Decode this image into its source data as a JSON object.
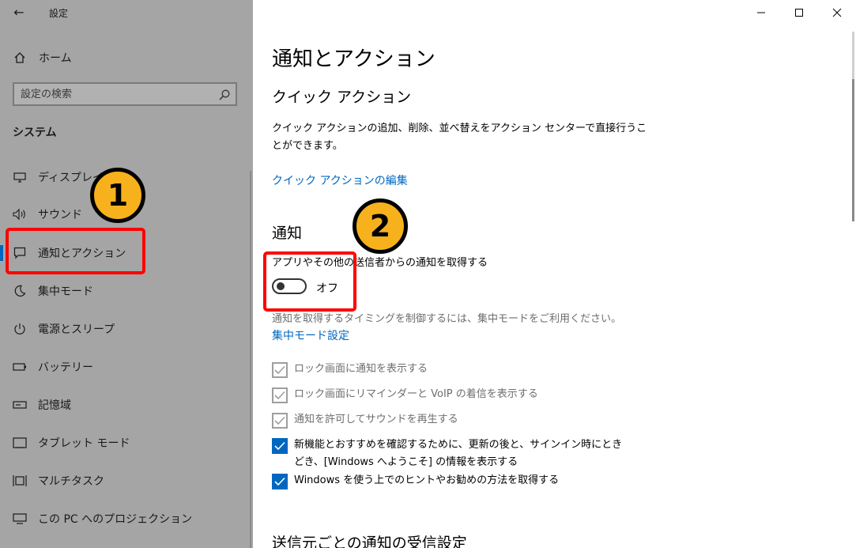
{
  "window": {
    "title": "設定",
    "back_glyph": "←",
    "caption": {
      "minimize": "—",
      "maximize": "☐",
      "close": "✕"
    }
  },
  "sidebar": {
    "home_label": "ホーム",
    "search_placeholder": "設定の検索",
    "section_title": "システム",
    "items": [
      {
        "label": "ディスプレイ",
        "icon": "monitor-icon"
      },
      {
        "label": "サウンド",
        "icon": "speaker-icon"
      },
      {
        "label": "通知とアクション",
        "icon": "message-icon",
        "active": true
      },
      {
        "label": "集中モード",
        "icon": "moon-icon"
      },
      {
        "label": "電源とスリープ",
        "icon": "power-icon"
      },
      {
        "label": "バッテリー",
        "icon": "battery-icon"
      },
      {
        "label": "記憶域",
        "icon": "storage-icon"
      },
      {
        "label": "タブレット モード",
        "icon": "tablet-icon"
      },
      {
        "label": "マルチタスク",
        "icon": "multitask-icon"
      },
      {
        "label": "この PC へのプロジェクション",
        "icon": "projection-icon"
      }
    ]
  },
  "main": {
    "page_title": "通知とアクション",
    "quick_actions": {
      "heading": "クイック アクション",
      "description_line1": "クイック アクションの追加、削除、並べ替えをアクション センターで直接行うこ",
      "description_line2": "とができます。",
      "edit_link": "クイック アクションの編集"
    },
    "notifications": {
      "heading": "通知",
      "toggle_label": "アプリやその他の送信者からの通知を取得する",
      "toggle_state": "オフ",
      "toggle_on": false,
      "focus_hint": "通知を取得するタイミングを制御するには、集中モードをご利用ください。",
      "focus_link": "集中モード設定",
      "checkboxes": [
        {
          "label": "ロック画面に通知を表示する",
          "checked": true,
          "disabled": true
        },
        {
          "label": "ロック画面にリマインダーと VoIP の着信を表示する",
          "checked": true,
          "disabled": true
        },
        {
          "label": "通知を許可してサウンドを再生する",
          "checked": true,
          "disabled": true
        },
        {
          "label": "新機能とおすすめを確認するために、更新の後と、サインイン時にときどき、[Windows へようこそ] の情報を表示する",
          "checked": true,
          "disabled": false
        },
        {
          "label": "Windows を使う上でのヒントやお勧めの方法を取得する",
          "checked": true,
          "disabled": false
        }
      ]
    },
    "per_sender_heading": "送信元ごとの通知の受信設定"
  },
  "annotations": {
    "badge1": "1",
    "badge2": "2",
    "badge_color": "#f6b11d",
    "box_color": "#ff0000"
  },
  "colors": {
    "accent": "#0067c0",
    "sidebar_bg": "#a5a5a5"
  }
}
